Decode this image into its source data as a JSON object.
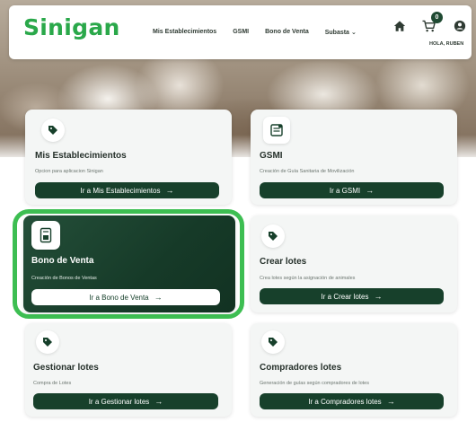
{
  "header": {
    "logo": "Sinigan",
    "nav": [
      {
        "label": "Mis Establecimientos"
      },
      {
        "label": "GSMI"
      },
      {
        "label": "Bono de Venta"
      },
      {
        "label": "Subasta"
      }
    ],
    "cart_count": "0",
    "greeting": "HOLA, RUBEN"
  },
  "cards": [
    {
      "title": "Mis Establecimientos",
      "desc": "Opcion para aplicacion Sinigan",
      "button": "Ir a Mis Establecimientos",
      "icon": "tag-icon"
    },
    {
      "title": "GSMI",
      "desc": "Creación de Guía Sanitaria de Movilización",
      "button": "Ir a GSMI",
      "icon": "document-icon"
    },
    {
      "title": "Bono de Venta",
      "desc": "Creación de Bonos de Ventas",
      "button": "Ir a Bono de Venta",
      "icon": "receipt-icon"
    },
    {
      "title": "Crear lotes",
      "desc": "Crea lotes según la asignación de animales",
      "button": "Ir a Crear lotes",
      "icon": "tag-icon"
    },
    {
      "title": "Gestionar lotes",
      "desc": "Compra de Lotes",
      "button": "Ir a Gestionar lotes",
      "icon": "tag-icon"
    },
    {
      "title": "Compradores lotes",
      "desc": "Generación de guías según compradores de lotes",
      "button": "Ir a Compradores lotes",
      "icon": "tag-icon"
    }
  ],
  "colors": {
    "brand_green": "#2aa84a",
    "dark_green": "#17402b",
    "highlight": "#3dbe52"
  }
}
